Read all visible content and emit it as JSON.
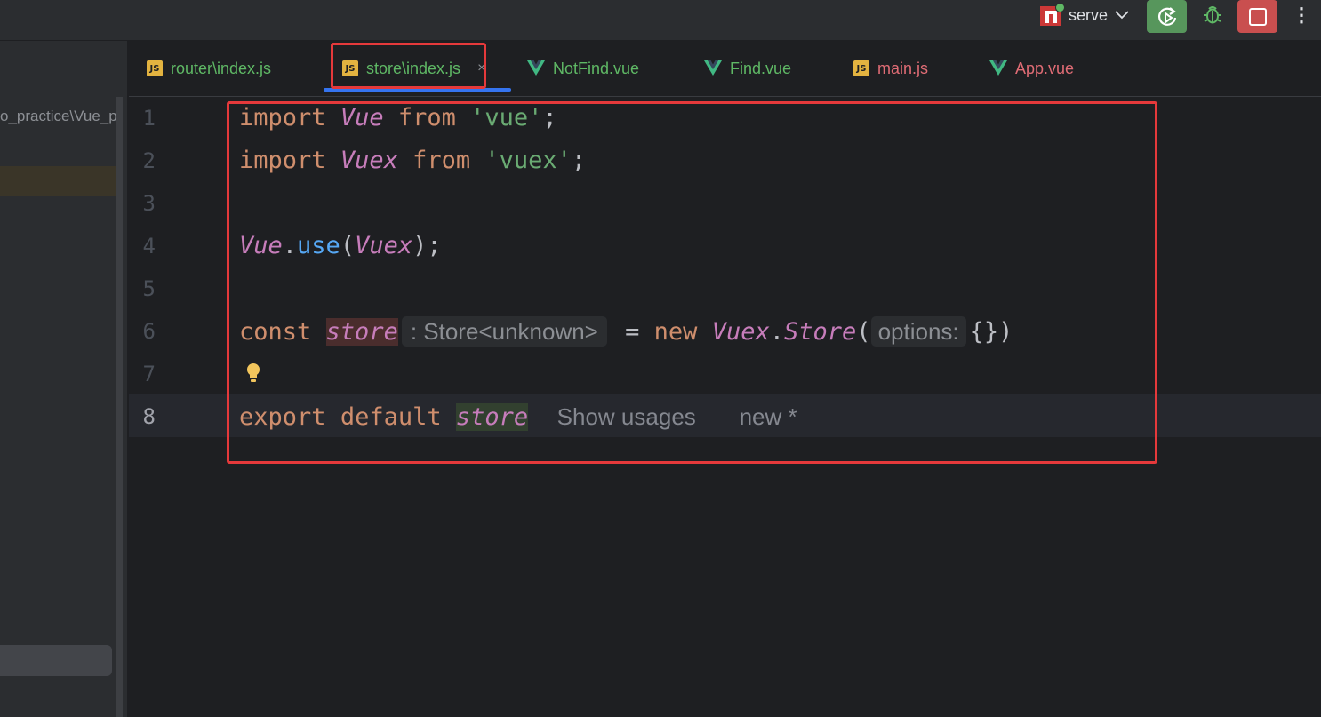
{
  "toolbar": {
    "run_config": "serve",
    "icons": [
      "npm-icon",
      "chevron-down-icon",
      "rerun-icon",
      "debug-bug-icon",
      "stop-icon",
      "more-vertical-icon"
    ]
  },
  "sidebar": {
    "path_text": "o_practice\\Vue_p"
  },
  "tabs": [
    {
      "label": "router\\index.js",
      "icon": "js",
      "color": "#5fb865"
    },
    {
      "label": "store\\index.js",
      "icon": "js",
      "color": "#5fb865",
      "active": true,
      "close": "×"
    },
    {
      "label": "NotFind.vue",
      "icon": "vue",
      "color": "#5fb865"
    },
    {
      "label": "Find.vue",
      "icon": "vue",
      "color": "#5fb865"
    },
    {
      "label": "main.js",
      "icon": "js",
      "color": "#e06c75"
    },
    {
      "label": "App.vue",
      "icon": "vue",
      "color": "#e06c75"
    }
  ],
  "editor": {
    "line_numbers": [
      "1",
      "2",
      "3",
      "4",
      "5",
      "6",
      "7",
      "8"
    ],
    "current_line": "8",
    "line1": {
      "kw": "import",
      "name": "Vue",
      "from": "from",
      "str": "'vue'",
      "end": ";"
    },
    "line2": {
      "kw": "import",
      "name": "Vuex",
      "from": "from",
      "str": "'vuex'",
      "end": ";"
    },
    "line4": {
      "obj": "Vue",
      "dot": ".",
      "fn": "use",
      "open": "(",
      "arg": "Vuex",
      "close": ");"
    },
    "line6": {
      "kw": "const",
      "var": "store",
      "type_hint": ": Store<unknown>",
      "eq": "=",
      "new": "new",
      "obj": "Vuex",
      "dot": ".",
      "cls": "Store",
      "open": "(",
      "param_hint": "options:",
      "rest": "{})"
    },
    "line8": {
      "kw1": "export",
      "kw2": "default",
      "var": "store",
      "usages": "Show usages",
      "author": "new *"
    }
  },
  "colors": {
    "keyword": "#cf8e6d",
    "italic_ident": "#c77dbb",
    "string": "#6aab73",
    "function": "#56a8f5",
    "highlight_border": "#e5393b",
    "active_tab_underline": "#3574f0"
  }
}
